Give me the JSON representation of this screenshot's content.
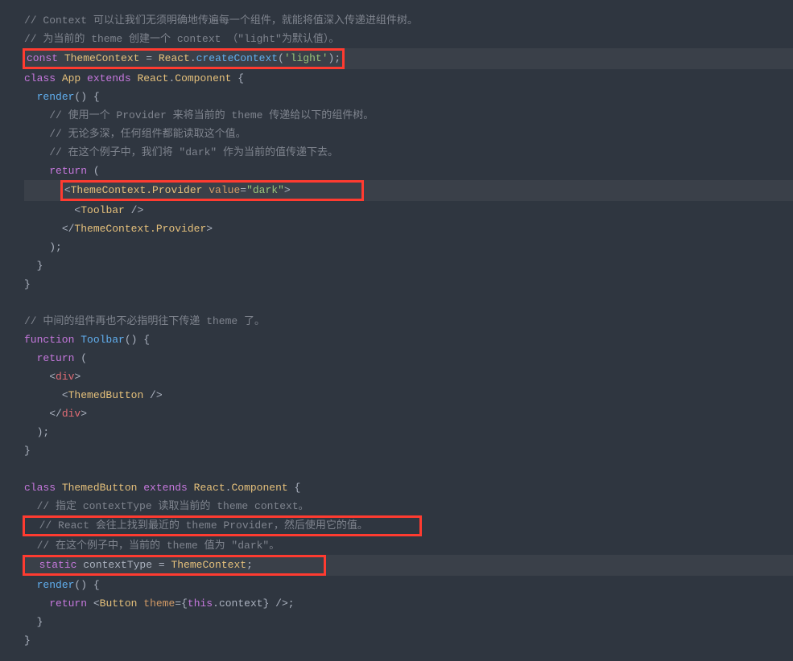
{
  "code": {
    "line1": "// Context 可以让我们无须明确地传遍每一个组件，就能将值深入传递进组件树。",
    "line2": "// 为当前的 theme 创建一个 context （\"light\"为默认值）。",
    "line3_const": "const",
    "line3_var": " ThemeContext ",
    "line3_eq": "= ",
    "line3_react": "React",
    "line3_dot": ".",
    "line3_fn": "createContext",
    "line3_open": "(",
    "line3_str": "'light'",
    "line3_close": ");",
    "line4_class": "class",
    "line4_app": " App ",
    "line4_extends": "extends",
    "line4_react": " React",
    "line4_dot": ".",
    "line4_comp": "Component",
    "line4_brace": " {",
    "line5_render": "render",
    "line5_paren": "() {",
    "line6": "// 使用一个 Provider 来将当前的 theme 传递给以下的组件树。",
    "line7": "// 无论多深，任何组件都能读取这个值。",
    "line8": "// 在这个例子中，我们将 \"dark\" 作为当前的值传递下去。",
    "line9_return": "return",
    "line9_paren": " (",
    "line10_open": "<",
    "line10_comp": "ThemeContext.Provider",
    "line10_attr": " value",
    "line10_eq": "=",
    "line10_str": "\"dark\"",
    "line10_close": ">",
    "line11_open": "<",
    "line11_comp": "Toolbar",
    "line11_close": " />",
    "line12_open": "</",
    "line12_comp": "ThemeContext.Provider",
    "line12_close": ">",
    "line13": ");",
    "line14": "}",
    "line15": "}",
    "line17": "// 中间的组件再也不必指明往下传递 theme 了。",
    "line18_fn": "function",
    "line18_name": " Toolbar",
    "line18_paren": "() {",
    "line19_return": "return",
    "line19_paren": " (",
    "line20_open": "<",
    "line20_tag": "div",
    "line20_close": ">",
    "line21_open": "<",
    "line21_comp": "ThemedButton",
    "line21_close": " />",
    "line22_open": "</",
    "line22_tag": "div",
    "line22_close": ">",
    "line23": ");",
    "line24": "}",
    "line26_class": "class",
    "line26_name": " ThemedButton ",
    "line26_extends": "extends",
    "line26_react": " React",
    "line26_dot": ".",
    "line26_comp": "Component",
    "line26_brace": " {",
    "line27": "// 指定 contextType 读取当前的 theme context。",
    "line28": "// React 会往上找到最近的 theme Provider，然后使用它的值。",
    "line29": "// 在这个例子中，当前的 theme 值为 \"dark\"。",
    "line30_static": "static",
    "line30_prop": " contextType ",
    "line30_eq": "= ",
    "line30_val": "ThemeContext",
    "line30_semi": ";",
    "line31_render": "render",
    "line31_paren": "() {",
    "line32_return": "return",
    "line32_sp": " ",
    "line32_open": "<",
    "line32_comp": "Button",
    "line32_attr": " theme",
    "line32_eq": "=",
    "line32_brace_o": "{",
    "line32_this": "this",
    "line32_dot": ".",
    "line32_ctx": "context",
    "line32_brace_c": "}",
    "line32_close": " />",
    "line32_semi": ";",
    "line33": "}",
    "line34": "}"
  }
}
